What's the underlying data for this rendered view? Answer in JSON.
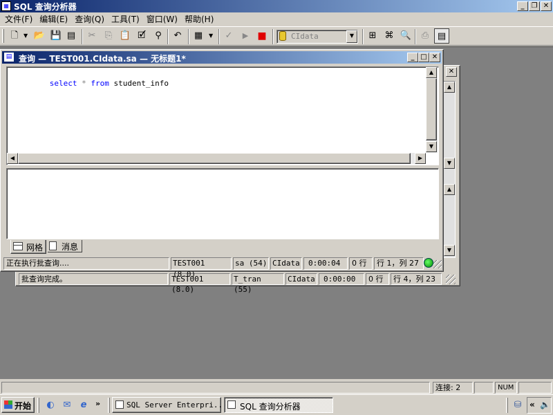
{
  "app": {
    "title": "SQL 查询分析器"
  },
  "menu": [
    "文件(F)",
    "编辑(E)",
    "查询(Q)",
    "工具(T)",
    "窗口(W)",
    "帮助(H)"
  ],
  "toolbar": {
    "database": "CIdata"
  },
  "query_window": {
    "title": "查询 — TEST001.CIdata.sa — 无标题1*",
    "sql_keyword_select": "select",
    "sql_star": "*",
    "sql_keyword_from": "from",
    "sql_table": "student_info",
    "tab_grid": "网格",
    "tab_messages": "消息",
    "status": {
      "message": "正在执行批查询....",
      "server": "TEST001 (8.0)",
      "user": "sa (54)",
      "db": "CIdata",
      "time": "0:00:04",
      "rows": "0 行",
      "position": "行 1，列 27"
    }
  },
  "back_window": {
    "status": {
      "message": "批查询完成。",
      "server": "TEST001 (8.0)",
      "user": "T_tran (55)",
      "db": "CIdata",
      "time": "0:00:00",
      "rows": "0 行",
      "position": "行 4，列 23"
    }
  },
  "statusbar": {
    "connections": "连接: 2",
    "num": "NUM"
  },
  "taskbar": {
    "start": "开始",
    "tasks": [
      "SQL Server Enterpri...",
      "SQL 查询分析器"
    ]
  },
  "colors": {
    "keyword": "#0000ff",
    "titlebar_active": "#0a246a",
    "workspace": "#808080"
  }
}
